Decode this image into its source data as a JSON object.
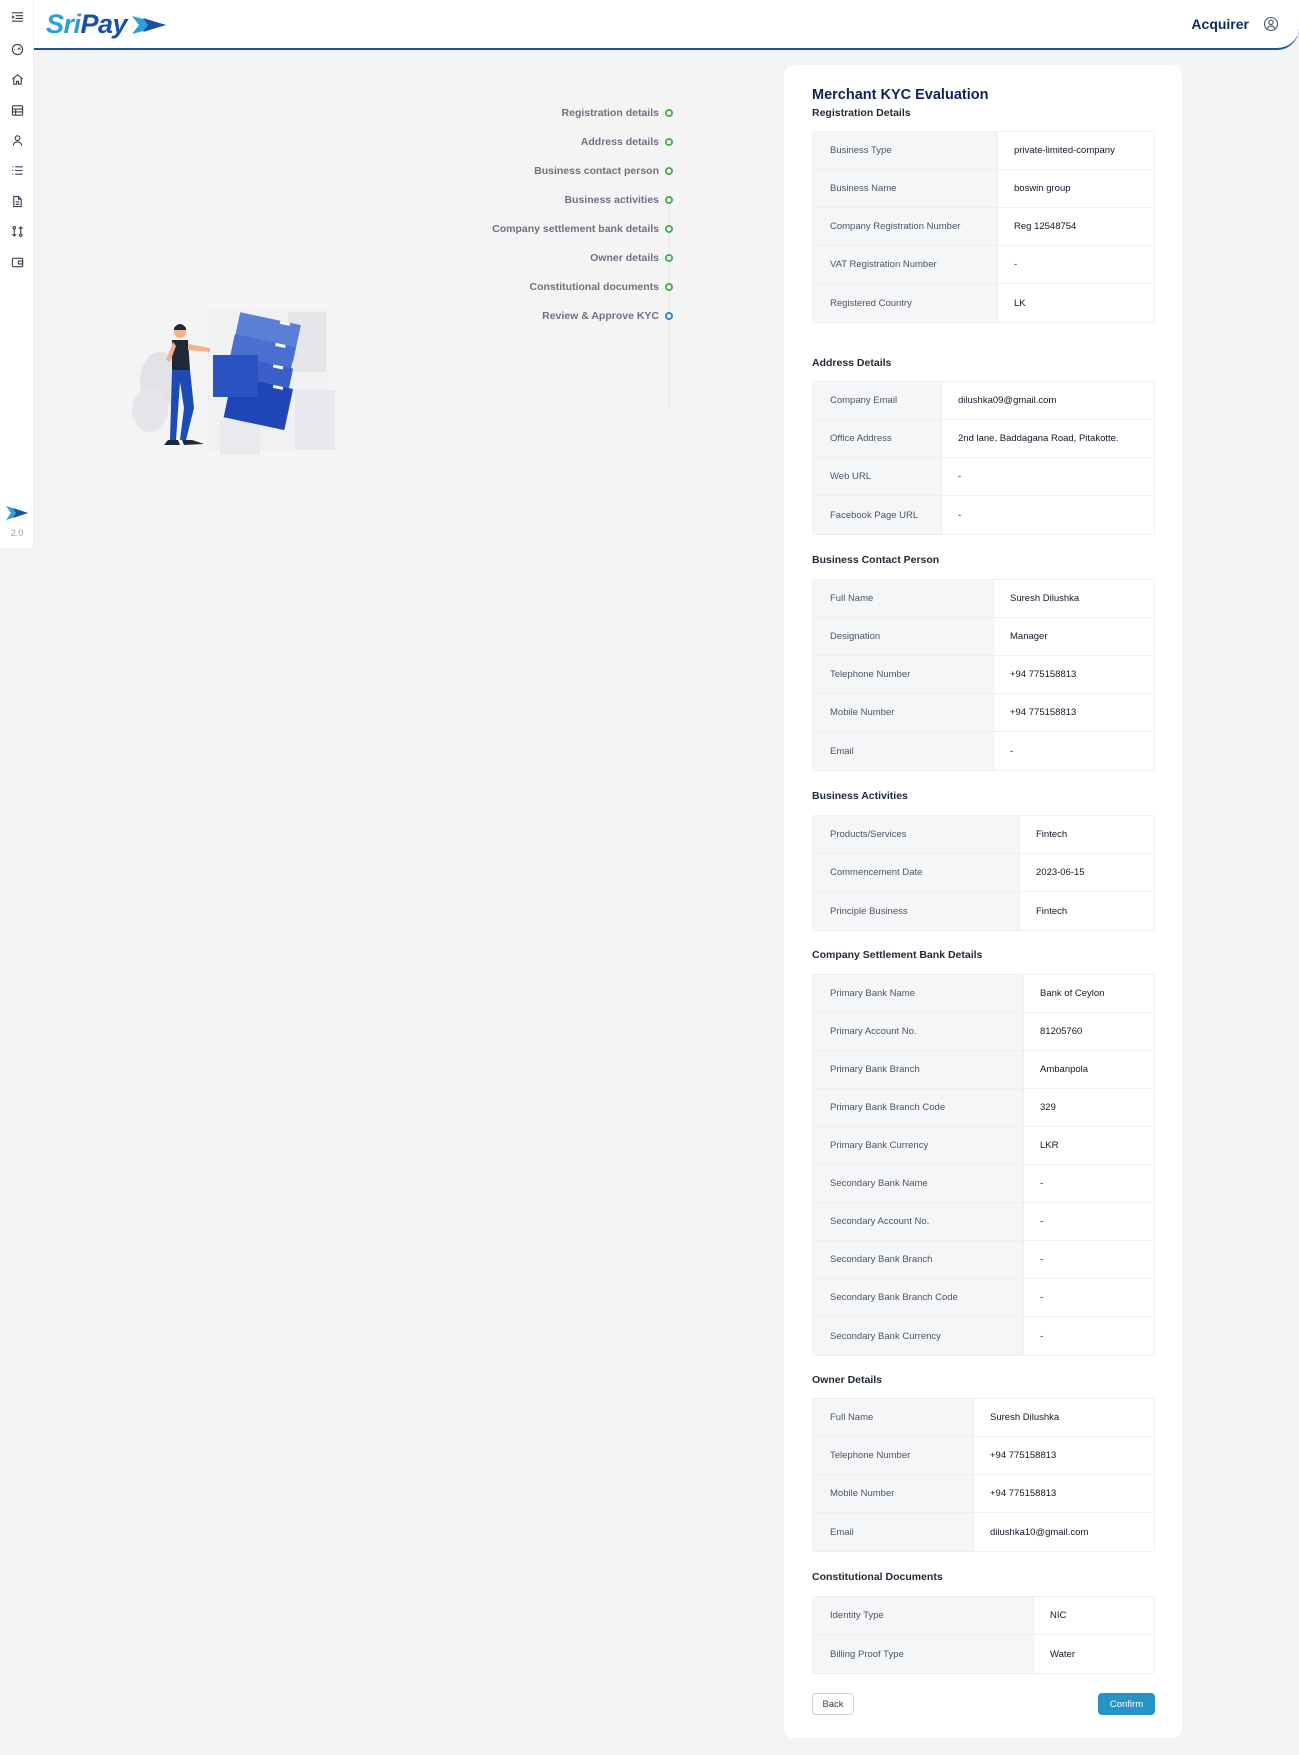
{
  "brand": {
    "name_part1": "Sri",
    "name_part2": "Pay",
    "version": "2.0"
  },
  "header": {
    "role": "Acquirer"
  },
  "sidebar": {
    "icons": [
      "menu-toggle-icon",
      "dashboard-icon",
      "home-icon",
      "table-icon",
      "user-icon",
      "list-icon",
      "document-icon",
      "transfer-icon",
      "wallet-icon"
    ]
  },
  "stepper": {
    "steps": [
      {
        "label": "Registration details",
        "status": "complete"
      },
      {
        "label": "Address details",
        "status": "complete"
      },
      {
        "label": "Business contact person",
        "status": "complete"
      },
      {
        "label": "Business activities",
        "status": "complete"
      },
      {
        "label": "Company settlement bank details",
        "status": "complete"
      },
      {
        "label": "Owner details",
        "status": "complete"
      },
      {
        "label": "Constitutional documents",
        "status": "complete"
      },
      {
        "label": "Review & Approve KYC",
        "status": "active"
      }
    ]
  },
  "card": {
    "title": "Merchant KYC Evaluation",
    "sections": [
      {
        "title": "Registration Details",
        "rows": [
          {
            "key": "Business Type",
            "value": "private-limited-company"
          },
          {
            "key": "Business Name",
            "value": "boswin group"
          },
          {
            "key": "Company Registration Number",
            "value": "Reg 12548754"
          },
          {
            "key": "VAT Registration Number",
            "value": "-"
          },
          {
            "key": "Registered Country",
            "value": "LK"
          }
        ]
      },
      {
        "title": "Address Details",
        "rows": [
          {
            "key": "Company Email",
            "value": "dilushka09@gmail.com"
          },
          {
            "key": "Office Address",
            "value": "2nd lane, Baddagana Road, Pitakotte."
          },
          {
            "key": "Web URL",
            "value": "-"
          },
          {
            "key": "Facebook Page URL",
            "value": "-"
          }
        ]
      },
      {
        "title": "Business Contact Person",
        "rows": [
          {
            "key": "Full Name",
            "value": "Suresh Dilushka"
          },
          {
            "key": "Designation",
            "value": "Manager"
          },
          {
            "key": "Telephone Number",
            "value": "+94 775158813"
          },
          {
            "key": "Mobile Number",
            "value": "+94 775158813"
          },
          {
            "key": "Email",
            "value": "-"
          }
        ]
      },
      {
        "title": "Business Activities",
        "rows": [
          {
            "key": "Products/Services",
            "value": "Fintech"
          },
          {
            "key": "Commencement Date",
            "value": "2023-06-15"
          },
          {
            "key": "Principle Business",
            "value": "Fintech"
          }
        ]
      },
      {
        "title": "Company Settlement Bank Details",
        "rows": [
          {
            "key": "Primary Bank Name",
            "value": "Bank of Ceylon"
          },
          {
            "key": "Primary Account No.",
            "value": "81205760"
          },
          {
            "key": "Primary Bank Branch",
            "value": "Ambanpola"
          },
          {
            "key": "Primary Bank Branch Code",
            "value": "329"
          },
          {
            "key": "Primary Bank Currency",
            "value": "LKR"
          },
          {
            "key": "Secondary Bank Name",
            "value": "-"
          },
          {
            "key": "Secondary Account No.",
            "value": "-"
          },
          {
            "key": "Secondary Bank Branch",
            "value": "-"
          },
          {
            "key": "Secondary Bank Branch Code",
            "value": "-"
          },
          {
            "key": "Secondary Bank Currency",
            "value": "-"
          }
        ]
      },
      {
        "title": "Owner Details",
        "rows": [
          {
            "key": "Full Name",
            "value": "Suresh Dilushka"
          },
          {
            "key": "Telephone Number",
            "value": "+94 775158813"
          },
          {
            "key": "Mobile Number",
            "value": "+94 775158813"
          },
          {
            "key": "Email",
            "value": "dilushka10@gmail.com"
          }
        ]
      },
      {
        "title": "Constitutional Documents",
        "rows": [
          {
            "key": "Identity Type",
            "value": "NIC"
          },
          {
            "key": "Billing Proof Type",
            "value": "Water"
          }
        ]
      }
    ],
    "back_label": "Back",
    "confirm_label": "Confirm"
  },
  "colors": {
    "brand_blue": "#1b4fa8",
    "brand_light_blue": "#2f9fd7",
    "step_complete": "#4caf50",
    "step_active": "#2f86c8",
    "confirm_button": "#2794c6"
  }
}
